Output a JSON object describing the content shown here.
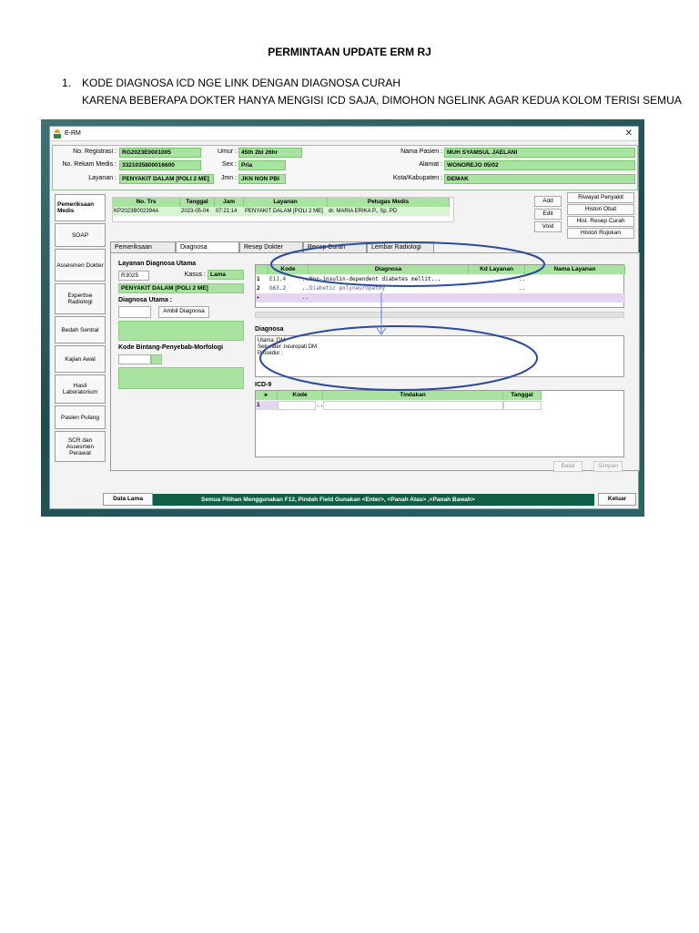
{
  "document": {
    "title": "PERMINTAAN UPDATE ERM RJ",
    "points": [
      {
        "number": "1.",
        "line1": "KODE DIAGNOSA ICD NGE LINK DENGAN DIAGNOSA CURAH",
        "line2": "KARENA BEBERAPA DOKTER HANYA MENGISI ICD SAJA, DIMOHON NGELINK AGAR KEDUA KOLOM TERISI SEMUA"
      }
    ]
  },
  "window": {
    "title": "E-RM",
    "close_glyph": "✕"
  },
  "patient": {
    "no_registrasi_label": "No. Registrasi :",
    "no_registrasi": "RG2023E0001005",
    "no_rm_label": "No. Rekam Medis :",
    "no_rm": "3321035800016600",
    "layanan_label": "Layanan :",
    "layanan": "PENYAKIT DALAM [POLI 2 ME]",
    "umur_label": "Umur :",
    "umur": "45th 2bl 26hr",
    "sex_label": "Sex :",
    "sex": "Pria",
    "jmn_label": "Jmn :",
    "jmn": "JKN NON PBI",
    "nama_label": "Nama Pasien :",
    "nama": "MUH SYAMSUL JAELANI",
    "alamat_label": "Alamat :",
    "alamat": "WONOREJO 05/02",
    "kota_label": "Kota/Kabupaten :",
    "kota": "DEMAK"
  },
  "sidebar": {
    "items": [
      {
        "label": "Pemeriksaan Medis"
      },
      {
        "label": "SOAP"
      },
      {
        "label": "Assesmen Dokter"
      },
      {
        "label": "Expertise Radiologi"
      },
      {
        "label": "Bedah Sentral"
      },
      {
        "label": "Kajian Awal"
      },
      {
        "label": "Hasil Laboratorium"
      },
      {
        "label": "Pasien Pulang"
      },
      {
        "label": "SCR dan Assesmen Perawat"
      }
    ]
  },
  "visits": {
    "headers": [
      "No. Trs",
      "Tanggal",
      "Jam",
      "Layanan",
      "Petugas Medis"
    ],
    "rows": [
      [
        "KP2023B002394A",
        "2023-05-04",
        "07:21:14",
        "PENYAKIT DALAM [POLI 2 ME]",
        "dr. MARIA ERIKA P., Sp. PD"
      ]
    ]
  },
  "actions": {
    "add": "Add",
    "edit": "Edit",
    "void": "Void",
    "riwayat_penyakit": "Riwayat Penyakit",
    "histori_obat": "Histori Obat",
    "hist_resep_curah": "Hist. Resep Curah",
    "histori_rujukan": "Histori Rujukan"
  },
  "tabs": [
    {
      "label": "Pemeriksaan"
    },
    {
      "label": "Diagnosa"
    },
    {
      "label": "Resep Dokter"
    },
    {
      "label": "Resep Curah"
    },
    {
      "label": "Lembar Radiologi"
    }
  ],
  "diagnosa": {
    "layanan_title": "Layanan Diagnosa Utama",
    "layanan_code": "R3025",
    "kasus_label": "Kasus :",
    "kasus_value": "Lama",
    "layanan_name": "PENYAKIT DALAM [POLI 2 ME]",
    "utama_title": "Diagnosa Utama :",
    "ambil_button": "Ambil Diagnosa",
    "bintang_title": "Kode Bintang-Penyebab-Morfologi",
    "icd_grid": {
      "headers": [
        "Kode",
        "Diagnosa",
        "Kd Layanan",
        "Nama Layanan"
      ],
      "rows": [
        {
          "no": "1",
          "kode": "E11.4",
          "diagnosa": "Non-insulin-dependent diabetes mellit..."
        },
        {
          "no": "2",
          "kode": "G63.2",
          "diagnosa": "Diabetic polyneuropathy"
        }
      ],
      "ellipsis": "..."
    },
    "curah_title": "Diagnosa",
    "curah_lines": [
      "Utama :DM",
      "Sekunder :neuropati DM",
      "Prosedur :"
    ],
    "icd9_title": "ICD-9",
    "icd9_headers": [
      "Kode",
      "Tindakan",
      "Tanggal"
    ],
    "icd9_row_no": "1",
    "batal": "Batal",
    "simpan": "Simpan"
  },
  "footer": {
    "data_lama": "Data Lama",
    "message": "Semua Pilihan Menggunakan F12,   Pindah Field Gunakan <Enter>, <Panah Atas> ,<Panah Bawah>",
    "keluar": "Keluar"
  },
  "colors": {
    "field_green": "#a8e4a0",
    "footer_green": "#0f5e45",
    "annotation_blue": "#2b4aa0"
  }
}
